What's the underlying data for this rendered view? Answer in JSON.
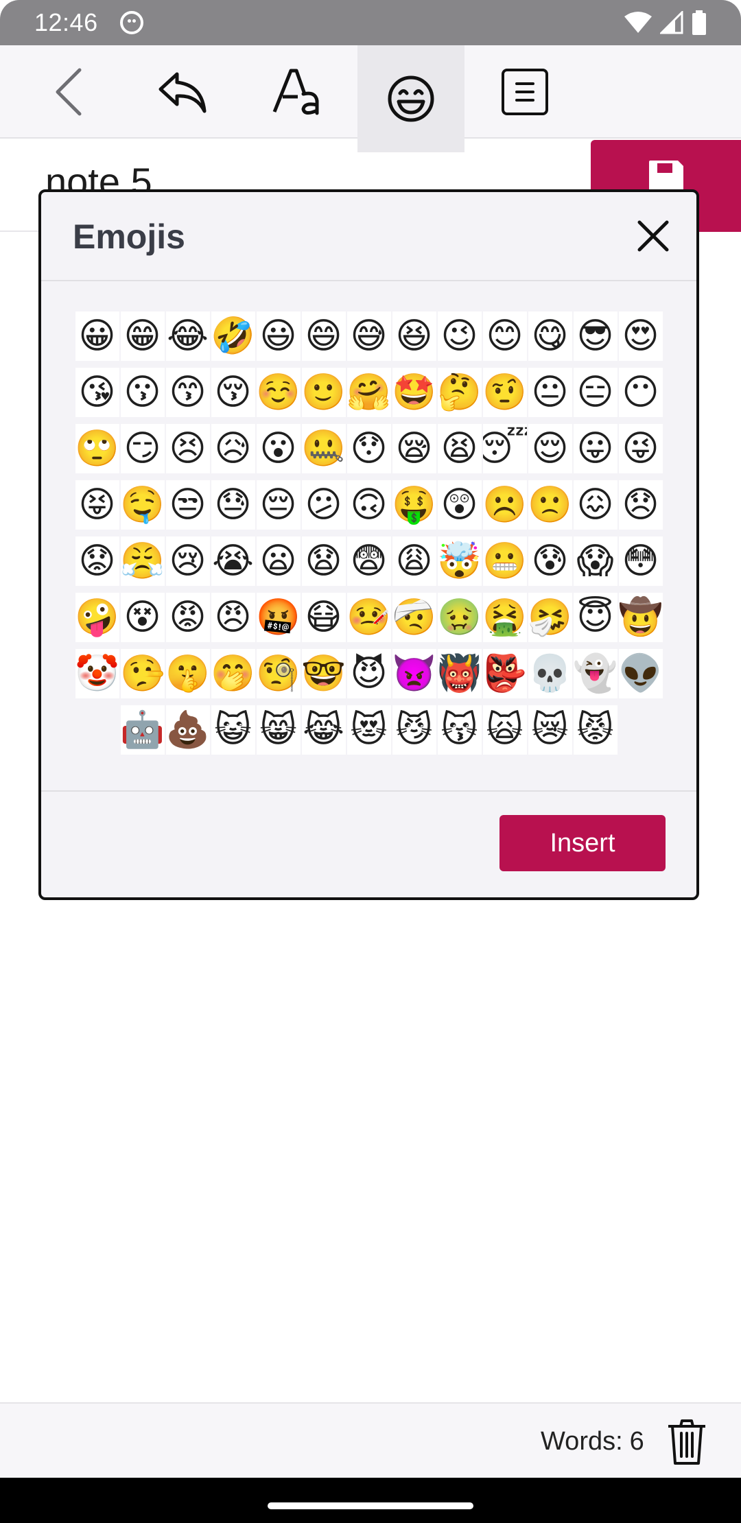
{
  "status_bar": {
    "time": "12:46"
  },
  "toolbar": {
    "items": [
      "back-icon",
      "undo-icon",
      "text-format-icon",
      "emoji-icon",
      "note-list-icon"
    ],
    "active": "emoji-icon"
  },
  "note": {
    "title": "note 5"
  },
  "dialog": {
    "title": "Emojis",
    "insert_label": "Insert",
    "emoji_rows": [
      [
        "😀",
        "😁",
        "😂",
        "🤣",
        "😃",
        "😄",
        "😅",
        "😆",
        "😉",
        "😊",
        "😋",
        "😎",
        "😍"
      ],
      [
        "😘",
        "😗",
        "😙",
        "😚",
        "☺️",
        "🙂",
        "🤗",
        "🤩",
        "🤔",
        "🤨",
        "😐",
        "😑",
        "😶"
      ],
      [
        "🙄",
        "😏",
        "😣",
        "😥",
        "😮",
        "🤐",
        "😯",
        "😪",
        "😫",
        "😴",
        "😌",
        "😛",
        "😜"
      ],
      [
        "😝",
        "🤤",
        "😒",
        "😓",
        "😔",
        "😕",
        "🙃",
        "🤑",
        "😲",
        "☹️",
        "🙁",
        "😖",
        "😞"
      ],
      [
        "😟",
        "😤",
        "😢",
        "😭",
        "😦",
        "😧",
        "😨",
        "😩",
        "🤯",
        "😬",
        "😰",
        "😱",
        "😳"
      ],
      [
        "🤪",
        "😵",
        "😡",
        "😠",
        "🤬",
        "😷",
        "🤒",
        "🤕",
        "🤢",
        "🤮",
        "🤧",
        "😇",
        "🤠"
      ],
      [
        "🤡",
        "🤥",
        "🤫",
        "🤭",
        "🧐",
        "🤓",
        "😈",
        "👿",
        "👹",
        "👺",
        "💀",
        "👻",
        "👽"
      ],
      [
        "🤖",
        "💩",
        "😺",
        "😸",
        "😹",
        "😻",
        "😼",
        "😽",
        "🙀",
        "😿",
        "😾"
      ]
    ]
  },
  "footer": {
    "words_label": "Words:",
    "words_count": "6"
  },
  "colors": {
    "accent": "#b8114f",
    "status_bar": "#878689"
  }
}
